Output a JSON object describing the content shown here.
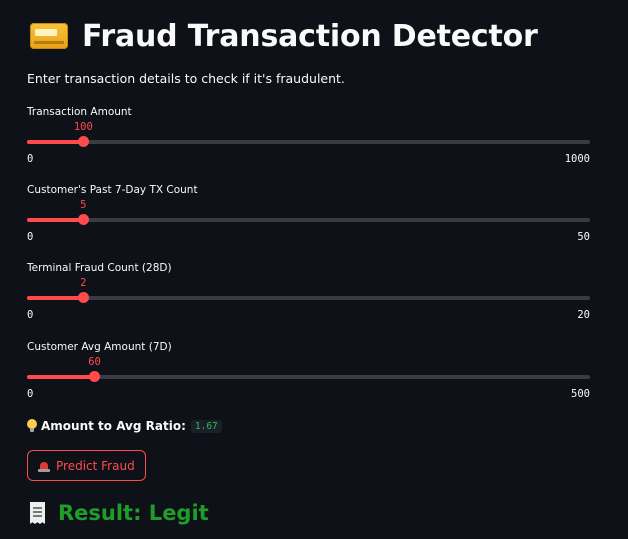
{
  "header": {
    "title": "Fraud Transaction Detector",
    "icon": "credit-card-icon"
  },
  "subtitle": "Enter transaction details to check if it's fraudulent.",
  "accent_color": "#ff4b4b",
  "sliders": [
    {
      "id": "transaction-amount",
      "label": "Transaction Amount",
      "value": 100,
      "min": 0,
      "max": 1000
    },
    {
      "id": "customer-7day-tx-count",
      "label": "Customer's Past 7-Day TX Count",
      "value": 5,
      "min": 0,
      "max": 50
    },
    {
      "id": "terminal-fraud-count",
      "label": "Terminal Fraud Count (28D)",
      "value": 2,
      "min": 0,
      "max": 20
    },
    {
      "id": "customer-avg-amount",
      "label": "Customer Avg Amount (7D)",
      "value": 60,
      "min": 0,
      "max": 500
    }
  ],
  "ratio": {
    "icon": "lightbulb-icon",
    "label": "Amount to Avg Ratio:",
    "value": "1.67"
  },
  "predict_button": {
    "icon": "siren-icon",
    "label": "Predict Fraud"
  },
  "result": {
    "icon": "receipt-icon",
    "text": "Result: Legit",
    "color": "#1f9d2b"
  }
}
